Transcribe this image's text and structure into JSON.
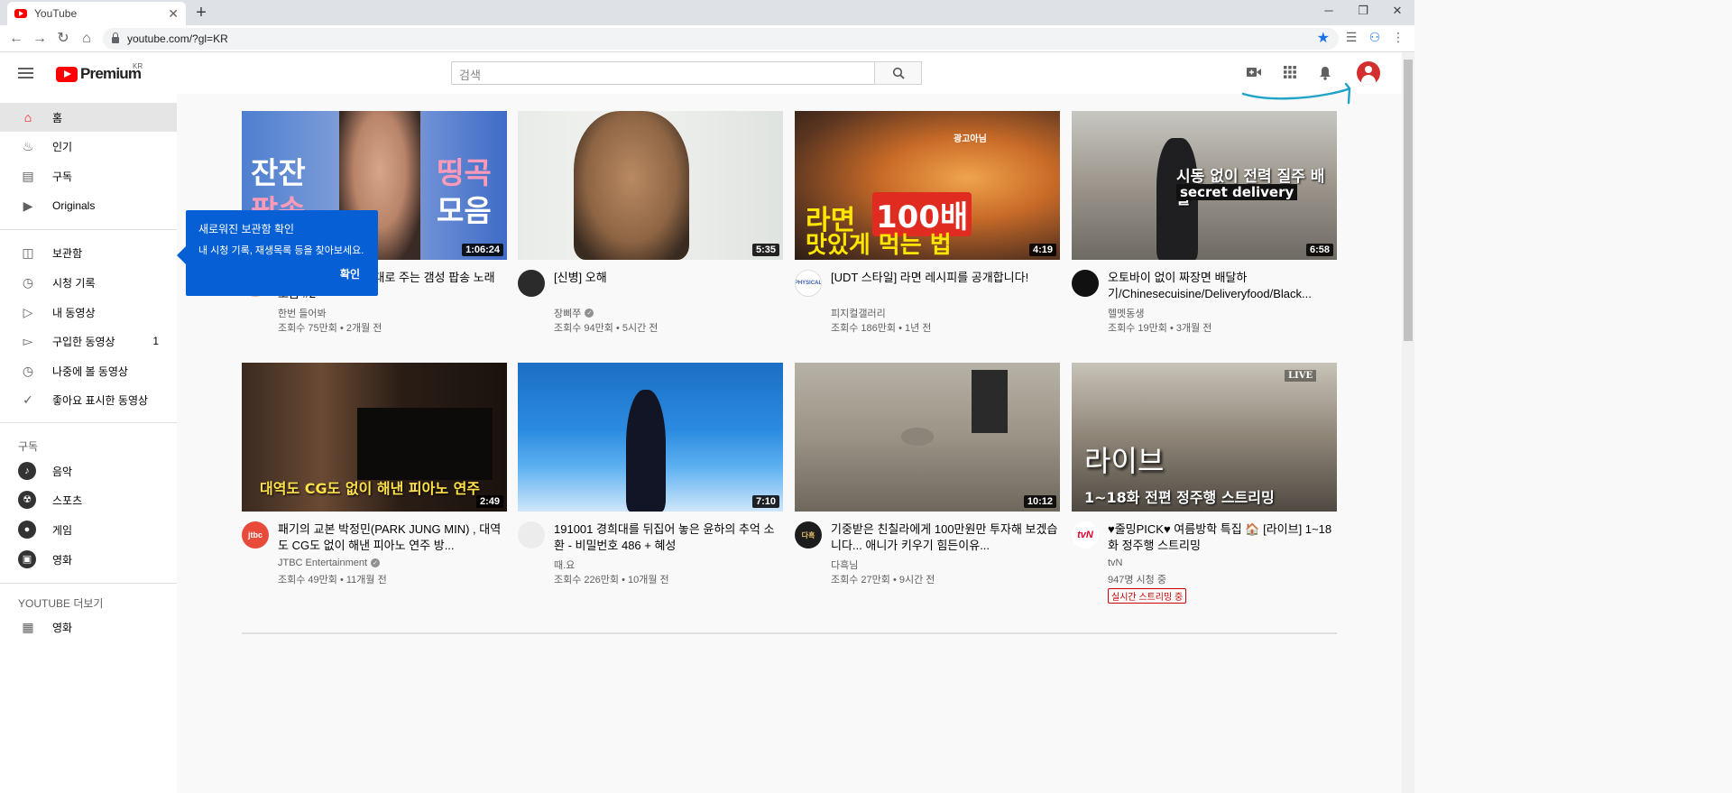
{
  "browser": {
    "tab_title": "YouTube",
    "url": "youtube.com/?gl=KR",
    "win_min": "─",
    "win_max": "❐",
    "win_close": "✕",
    "tab_close": "✕",
    "new_tab": "+"
  },
  "masthead": {
    "logo_text": "Premium",
    "region": "KR",
    "search_placeholder": "검색"
  },
  "sidebar": {
    "items": [
      {
        "label": "홈",
        "icon": "home-icon"
      },
      {
        "label": "인기",
        "icon": "trending-icon"
      },
      {
        "label": "구독",
        "icon": "subscriptions-icon"
      },
      {
        "label": "Originals",
        "icon": "originals-icon"
      },
      {
        "label": "보관함",
        "icon": "library-icon"
      },
      {
        "label": "시청 기록",
        "icon": "history-icon"
      },
      {
        "label": "내 동영상",
        "icon": "your-videos-icon"
      },
      {
        "label": "구입한 동영상",
        "icon": "purchases-icon",
        "count": "1"
      },
      {
        "label": "나중에 볼 동영상",
        "icon": "watch-later-icon"
      },
      {
        "label": "좋아요 표시한 동영상",
        "icon": "liked-icon"
      }
    ],
    "subs_heading": "구독",
    "subs": [
      {
        "label": "음악"
      },
      {
        "label": "스포츠"
      },
      {
        "label": "게임"
      },
      {
        "label": "영화"
      }
    ],
    "more_heading": "YOUTUBE 더보기",
    "more": [
      {
        "label": "영화"
      }
    ]
  },
  "tooltip": {
    "title": "새로워진 보관함 확인",
    "body": "내 시청 기록, 재생목록 등을 찾아보세요.",
    "ok": "확인"
  },
  "videos": [
    {
      "title": "귀가 녹을것 같은 제대로 주는 갬성 팝송 노래 모음 #2",
      "channel": "한번 들어봐",
      "meta": "조회수 75만회 • 2개월 전",
      "duration": "1:06:24",
      "overlay1": "잔잔",
      "overlay2": "팝송",
      "overlay3": "띵곡",
      "overlay4": "모음"
    },
    {
      "title": "[신병] 오해",
      "channel": "장삐쭈",
      "meta": "조회수 94만회 • 5시간 전",
      "duration": "5:35",
      "verified": true
    },
    {
      "title": "[UDT 스타일] 라면 레시피를 공개합니다!",
      "channel": "피지컬갤러리",
      "meta": "조회수 186만회 • 1년 전",
      "duration": "4:19",
      "overlay1": "라면",
      "overlay2": "100배",
      "overlay3": "맛있게 먹는 법",
      "overlay4": "광고아님",
      "ch_logo": "PHYSICAL"
    },
    {
      "title": "오토바이 없이 짜장면 배달하기/Chinesecuisine/Deliveryfood/Black...",
      "channel": "헬멧동생",
      "meta": "조회수 19만회 • 3개월 전",
      "duration": "6:58",
      "overlay1": "시동 없이 전력 질주 배달",
      "overlay2": "secret delivery"
    },
    {
      "title": "패기의 교본 박정민(PARK JUNG MIN) , 대역도 CG도 없이 해낸 피아노 연주 방...",
      "channel": "JTBC Entertainment",
      "meta": "조회수 49만회 • 11개월 전",
      "duration": "2:49",
      "verified": true,
      "overlay1": "대역도 CG도 없이 해낸 피아노 연주",
      "ch_logo": "jtbc"
    },
    {
      "title": "191001 경희대를 뒤집어 놓은 윤하의 추억 소환 - 비밀번호 486 + 혜성",
      "channel": "때.요",
      "meta": "조회수 226만회 • 10개월 전",
      "duration": "7:10"
    },
    {
      "title": "기중받은 친칠라에게 100만원만 투자해 보겠습니다... 애니가 키우기 힘든이유...",
      "channel": "다흑님",
      "meta": "조회수 27만회 • 9시간 전",
      "duration": "10:12",
      "ch_logo": "다흑"
    },
    {
      "title": "♥줄밍PICK♥ 여름방학 특집 🏠 [라이브] 1~18화 정주행 스트리밍",
      "channel": "tvN",
      "meta": "947명 시청 중",
      "live_badge": "실시간 스트리밍 중",
      "overlay1": "라이브",
      "overlay2": "1~18화 전편 정주행 스트리밍",
      "overlay3": "LIVE",
      "ch_logo": "tvN"
    }
  ],
  "colors": {
    "accent": "#ff0000",
    "tooltip": "#065fd4",
    "annotation": "#1fa3c9"
  }
}
